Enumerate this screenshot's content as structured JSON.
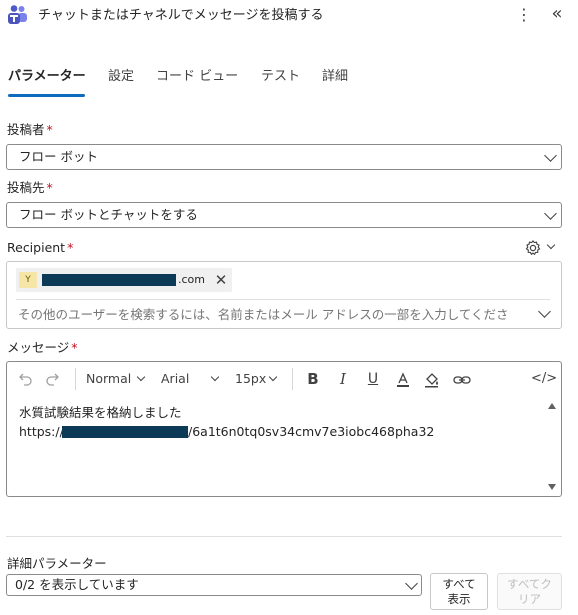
{
  "header": {
    "title": "チャットまたはチャネルでメッセージを投稿する",
    "app_icon": "teams-icon",
    "more_icon": "more-vertical-icon",
    "collapse_icon": "collapse-left-icon"
  },
  "tabs": [
    {
      "label": "パラメーター",
      "active": true
    },
    {
      "label": "設定",
      "active": false
    },
    {
      "label": "コード ビュー",
      "active": false
    },
    {
      "label": "テスト",
      "active": false
    },
    {
      "label": "詳細",
      "active": false
    }
  ],
  "form": {
    "post_as": {
      "label": "投稿者",
      "required_mark": "*",
      "value": "フロー ボット"
    },
    "post_in": {
      "label": "投稿先",
      "required_mark": "*",
      "value": "フロー ボットとチャットをする"
    },
    "recipient": {
      "label": "Recipient",
      "required_mark": "*",
      "chip_initial": "Y",
      "chip_domain": ".com",
      "search_placeholder": "その他のユーザーを検索するには、名前またはメール アドレスの一部を入力してくださ"
    },
    "message": {
      "label": "メッセージ",
      "required_mark": "*",
      "toolbar": {
        "style": "Normal",
        "font": "Arial",
        "size": "15px",
        "bold": "B",
        "italic": "I",
        "underline": "U"
      },
      "line1": "水質試験結果を格納しました",
      "line2_prefix": "https://",
      "line2_suffix": "/6a1t6n0tq0sv34cmv7e3iobc468pha32"
    }
  },
  "advanced": {
    "label": "詳細パラメーター",
    "select_value": "0/2 を表示しています",
    "show_all_button": "すべて\n表示",
    "clear_all_button": "すべてク\nリア"
  },
  "colors": {
    "accent": "#0f6cbd",
    "required": "#c50f1f",
    "redaction": "#0d3b57"
  }
}
